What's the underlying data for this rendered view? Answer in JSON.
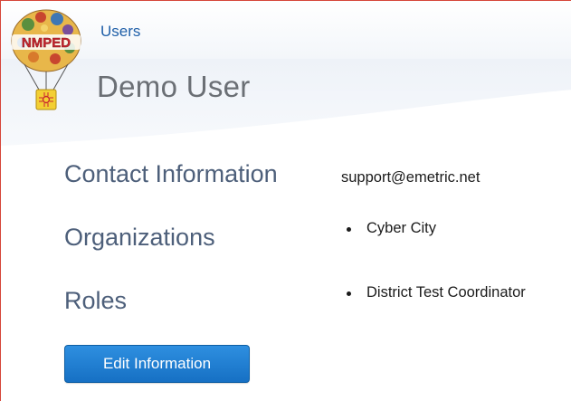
{
  "header": {
    "logo_text": "NMPED",
    "breadcrumb": "Users",
    "title": "Demo User"
  },
  "sections": {
    "contact": {
      "label": "Contact Information",
      "email": "support@emetric.net"
    },
    "organizations": {
      "label": "Organizations",
      "items": [
        "Cyber City"
      ]
    },
    "roles": {
      "label": "Roles",
      "items": [
        "District Test Coordinator"
      ]
    }
  },
  "actions": {
    "edit_label": "Edit Information"
  },
  "colors": {
    "frame_border": "#d6463a",
    "link": "#1f5fa8",
    "section_label": "#4d5f7a",
    "button_top": "#2e8fe0",
    "button_bottom": "#1670c4"
  }
}
